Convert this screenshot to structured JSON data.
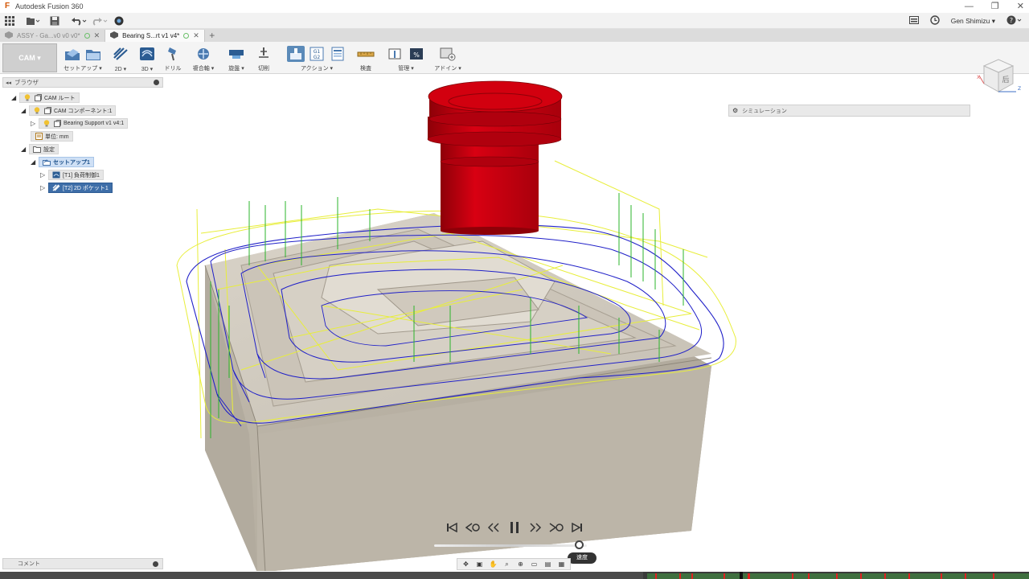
{
  "window": {
    "title": "Autodesk Fusion 360",
    "controls": [
      "—",
      "❐",
      "✕"
    ]
  },
  "quick_access": {
    "user_name": "Gen Shimizu ▾"
  },
  "tabs": [
    {
      "label": "ASSY - Ga...v0 v0 v0*",
      "active": false
    },
    {
      "label": "Bearing S...rt v1 v4*",
      "active": true
    }
  ],
  "ribbon": {
    "workspace": "CAM ▾",
    "groups": [
      {
        "label": "セットアップ ▾"
      },
      {
        "label": "2D ▾"
      },
      {
        "label": "3D ▾"
      },
      {
        "label": "ドリル"
      },
      {
        "label": "複合軸 ▾"
      },
      {
        "label": "旋盤 ▾"
      },
      {
        "label": "切削"
      },
      {
        "label": "アクション ▾"
      },
      {
        "label": "検査"
      },
      {
        "label": "管理 ▾"
      },
      {
        "label": "アドイン ▾"
      }
    ]
  },
  "browser": {
    "title": "ブラウザ",
    "nodes": [
      {
        "label": "CAM ルート"
      },
      {
        "label": "CAM コンポーネント:1"
      },
      {
        "label": "Bearing Support v1 v4:1"
      },
      {
        "label": "単位: mm"
      },
      {
        "label": "設定"
      },
      {
        "label": "セットアップ1"
      },
      {
        "label": "[T1] 負荷制御1"
      },
      {
        "label": "[T2] 2D ポケット1"
      }
    ]
  },
  "comment": {
    "title": "コメント"
  },
  "simulation": {
    "title": "シミュレーション"
  },
  "playback": {
    "speed_label": "速度"
  },
  "colors": {
    "tool": "#c8000f",
    "toolpath_blue": "#2020c8",
    "toolpath_yellow": "#e8ee3a",
    "toolpath_green": "#2bb52b",
    "stock": "#bdb6a8",
    "active_ribbon": "#5b8ab8"
  }
}
